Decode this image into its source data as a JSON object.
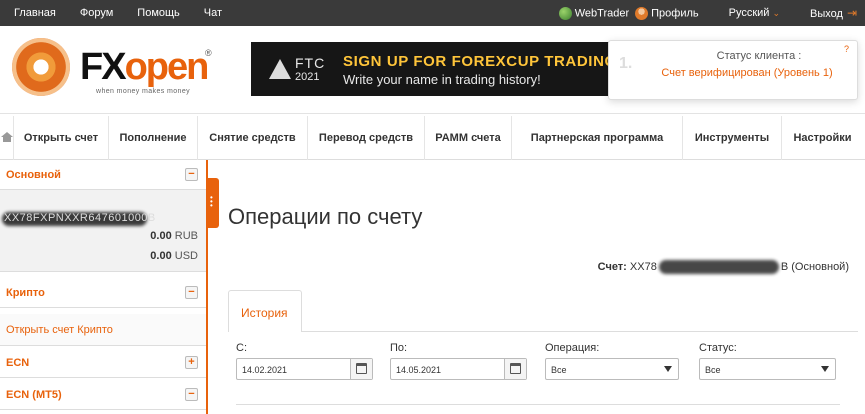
{
  "topbar": {
    "links": [
      "Главная",
      "Форум",
      "Помощь",
      "Чат"
    ],
    "webtrader": "WebTrader",
    "profile": "Профиль",
    "language": "Русский",
    "logout": "Выход"
  },
  "brand": {
    "fx": "FX",
    "open": "open",
    "reg": "®",
    "tagline": "when money makes money"
  },
  "banner": {
    "ftc": "FTC",
    "year": "2021",
    "line1": "SIGN UP FOR FOREXCUP TRADING",
    "line2": "Write your name in trading history!"
  },
  "client_status": {
    "step": "1.",
    "help": "?",
    "title": "Статус клиента :",
    "value": "Счет верифицирован (Уровень 1)"
  },
  "nav": {
    "items": [
      "Открыть счет",
      "Пополнение",
      "Снятие средств",
      "Перевод средств",
      "PAMM счета",
      "Партнерская программа",
      "Инструменты",
      "Настройки"
    ]
  },
  "sidebar": {
    "main_label": "Основной",
    "account_id": "XX78FXPNXXR647601000B",
    "balance_rub_value": "0.00",
    "balance_rub_cur": "RUB",
    "balance_usd_value": "0.00",
    "balance_usd_cur": "USD",
    "crypto_label": "Крипто",
    "open_crypto": "Открыть счет Крипто",
    "ecn_label": "ECN",
    "ecn_mt5_label": "ECN (MT5)",
    "collapse_symbol": "−",
    "expand_symbol": "+"
  },
  "main": {
    "title": "Операции по счету",
    "account_label": "Счет:",
    "account_prefix": "XX78",
    "account_suffix": "B (Основной)",
    "tab_history": "История"
  },
  "filters": {
    "from_label": "С:",
    "from_value": "14.02.2021",
    "to_label": "По:",
    "to_value": "14.05.2021",
    "operation_label": "Операция:",
    "operation_value": "Все",
    "status_label": "Статус:",
    "status_value": "Все"
  }
}
